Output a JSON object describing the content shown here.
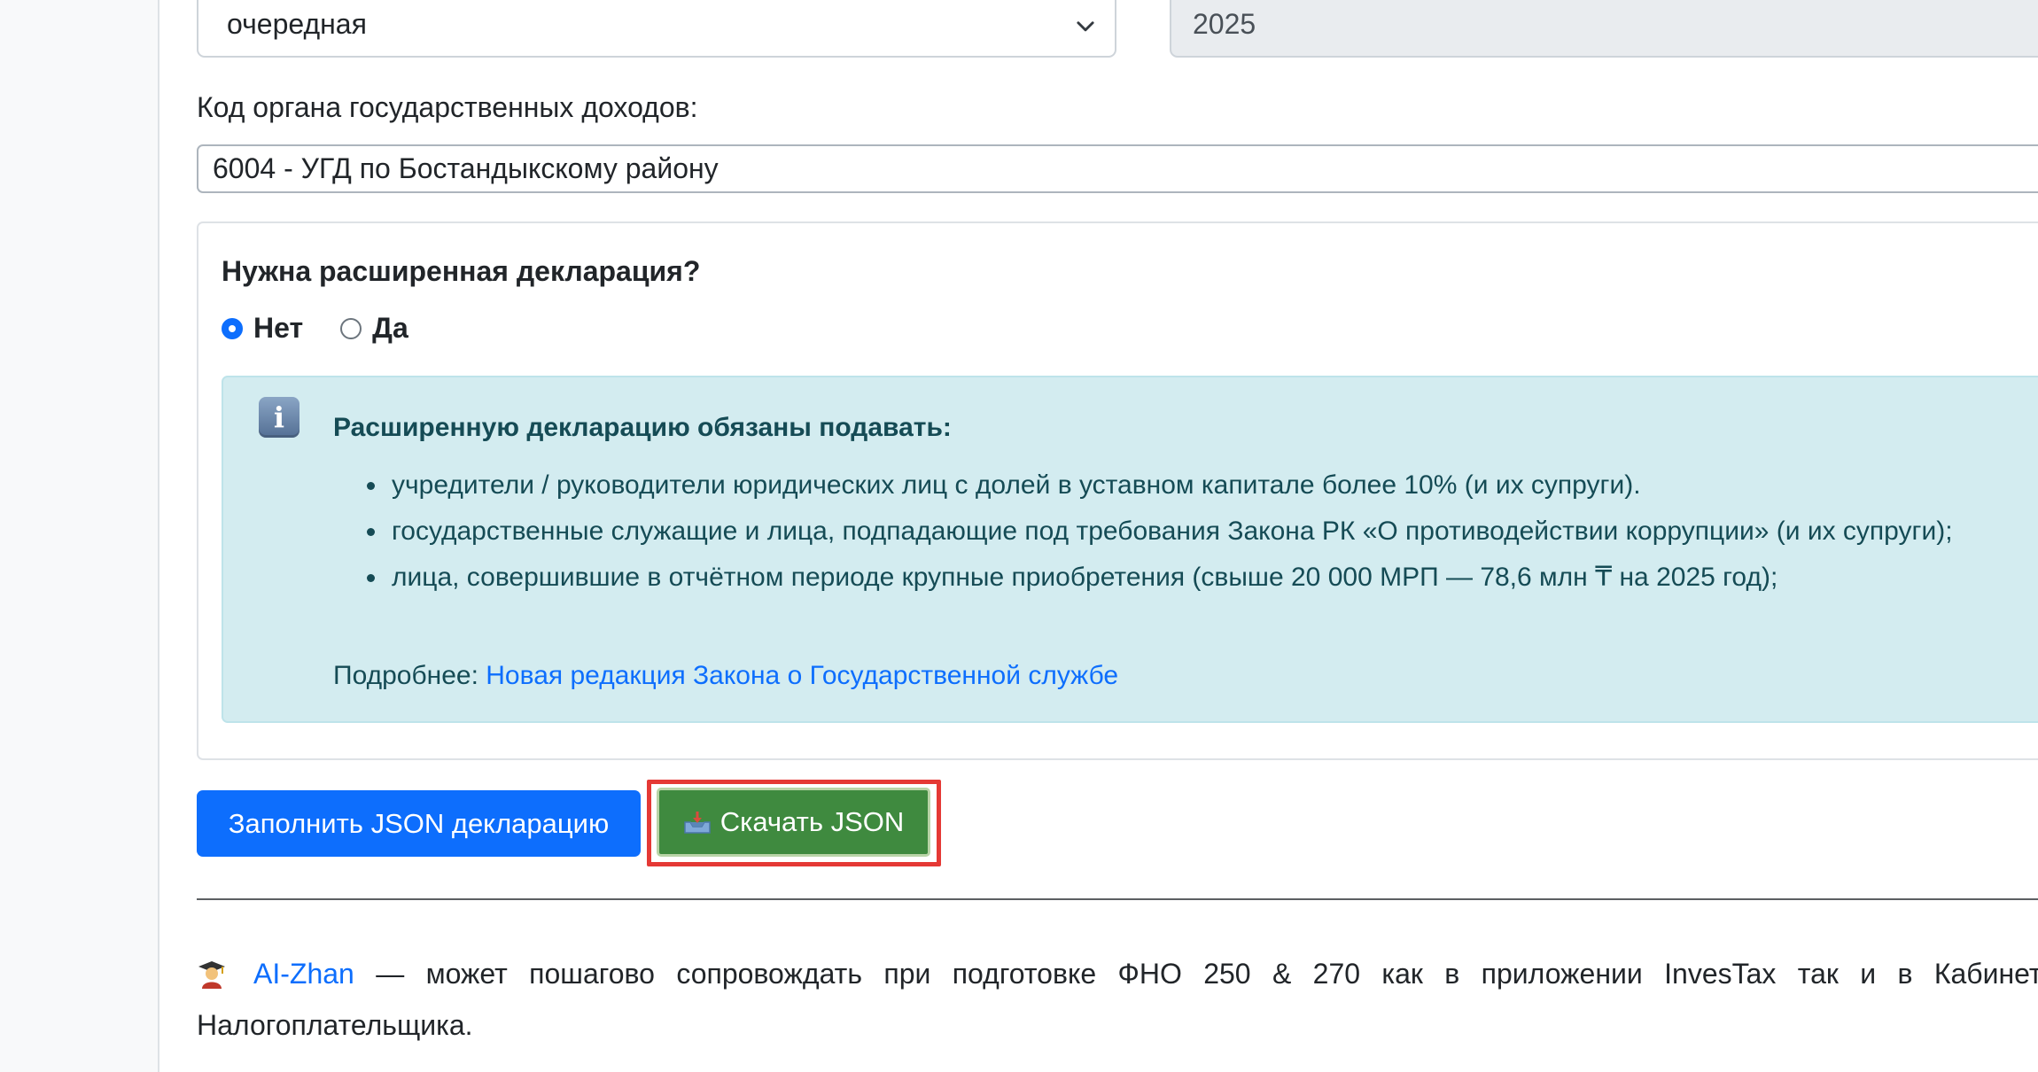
{
  "form": {
    "declaration_type_value": "очередная",
    "year_value": "2025",
    "org_label": "Код органа государственных доходов:",
    "org_value": "6004 - УГД по Бостандыкскому району"
  },
  "extended": {
    "question": "Нужна расширенная декларация?",
    "options": [
      {
        "label": "Нет",
        "checked": true
      },
      {
        "label": "Да",
        "checked": false
      }
    ]
  },
  "info_alert": {
    "icon": "info-icon",
    "title": "Расширенную декларацию обязаны подавать:",
    "items": [
      "учредители / руководители юридических лиц с долей в уставном капитале более 10% (и их супруги).",
      "государственные служащие и лица, подпадающие под требования Закона РК «О противодействии коррупции» (и их супруги);",
      "лица, совершившие в отчётном периоде крупные приобретения (свыше 20 000 МРП — 78,6 млн ₸ на 2025 год);"
    ],
    "more_prefix": "Подробнее: ",
    "more_link": "Новая редакция Закона о Государственной службе"
  },
  "actions": {
    "fill_label": "Заполнить JSON декларацию",
    "download_label": "Скачать JSON",
    "download_icon": "inbox-tray-icon"
  },
  "footer": {
    "emoji": "student-emoji-icon",
    "link": "AI-Zhan",
    "text": " — может пошагово сопровождать при подготовке ФНО 250 & 270 как в приложении InvesTax так и в Кабинете Налогоплательщика."
  },
  "colors": {
    "primary": "#0d6efd",
    "success": "#3f8a3f",
    "alert_bg": "#d3ecf0",
    "highlight": "#e53935"
  }
}
